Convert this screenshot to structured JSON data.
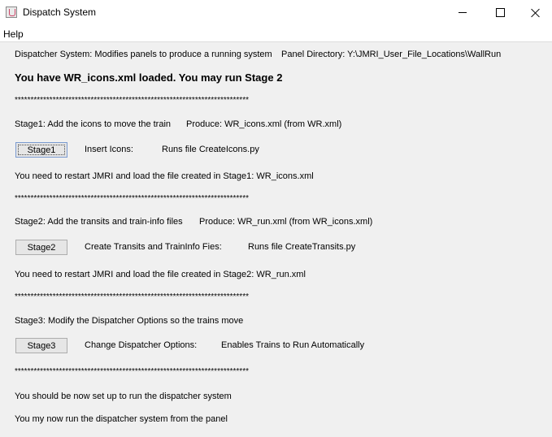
{
  "window": {
    "title": "Dispatch System"
  },
  "menu": {
    "items": [
      "Help"
    ]
  },
  "header": {
    "description": "Dispatcher System: Modifies panels to produce a running system",
    "panel_directory": "Panel Directory: Y:\\JMRI_User_File_Locations\\WallRun",
    "status": "You have WR_icons.xml loaded. You may run Stage 2"
  },
  "separator": "**************************************************************************",
  "stage1": {
    "title": "Stage1: Add the icons to move the train",
    "produce": "Produce: WR_icons.xml (from WR.xml)",
    "button": "Stage1",
    "action": "Insert Icons:",
    "runs": "Runs file CreateIcons.py",
    "restart": "You need to restart JMRI and load the file created in Stage1: WR_icons.xml"
  },
  "stage2": {
    "title": "Stage2: Add the transits and train-info files",
    "produce": "Produce: WR_run.xml (from WR_icons.xml)",
    "button": "Stage2",
    "action": "Create Transits and TrainInfo Fies:",
    "runs": "Runs file CreateTransits.py",
    "restart": "You need to restart JMRI and load the file created in Stage2: WR_run.xml"
  },
  "stage3": {
    "title": "Stage3: Modify the Dispatcher Options so the trains move",
    "button": "Stage3",
    "action": "Change Dispatcher Options:",
    "runs": "Enables Trains to Run Automatically"
  },
  "footer": {
    "line1": "You should be now set up to run the dispatcher system",
    "line2": "You my now run the dispatcher system from the panel"
  }
}
